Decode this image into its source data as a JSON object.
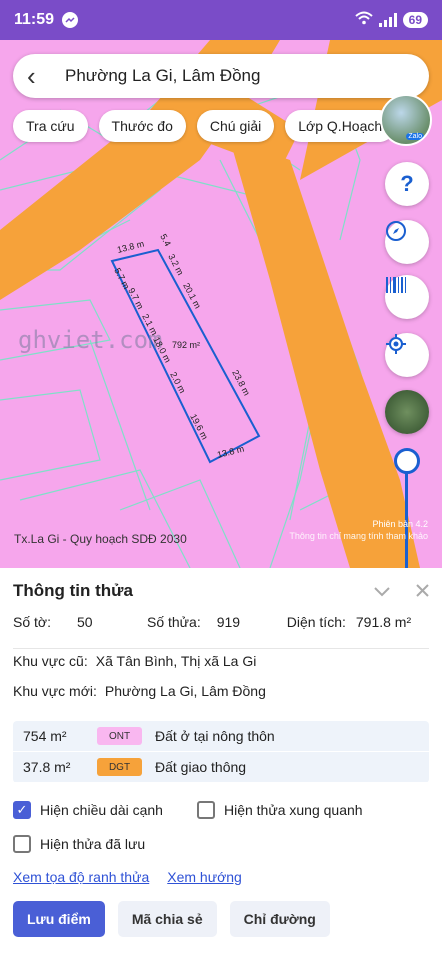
{
  "status": {
    "time": "11:59",
    "battery": "69"
  },
  "search": {
    "title": "Phường La Gi, Lâm Đồng"
  },
  "chips": [
    "Tra cứu",
    "Thước đo",
    "Chú giải",
    "Lớp Q.Hoạch"
  ],
  "avatar": {
    "badge": "Zalo"
  },
  "fab": {
    "help": "?"
  },
  "map": {
    "watermark": "ghviet.com",
    "dims": [
      "13.8 m",
      "5.4",
      "3.2 m",
      "20.1 m",
      "23.8 m",
      "19.6 m",
      "13.8 m",
      "5.7 m",
      "9.7 m",
      "2.1 m",
      "18.0 m",
      "2.0 m"
    ],
    "area_label": "792 m²",
    "version_line1": "Phiên bản 4.2",
    "version_line2": "Thông tin chỉ mang tính tham khảo",
    "layer_label": "Tx.La Gi - Quy hoạch SDĐ 2030",
    "colors": {
      "residential": "#f6a6ec",
      "road": "#f6a23a",
      "parcel_line": "#7fe0c8",
      "selected": "#1a5fd0"
    }
  },
  "panel": {
    "title": "Thông tin thửa",
    "so_to_label": "Số tờ:",
    "so_to": "50",
    "so_thua_label": "Số thửa:",
    "so_thua": "919",
    "dien_tich_label": "Diện tích:",
    "dien_tich": "791.8 m²",
    "kv_cu_label": "Khu vực cũ:",
    "kv_cu": "Xã Tân Bình, Thị xã La Gi",
    "kv_moi_label": "Khu vực mới:",
    "kv_moi": "Phường La Gi, Lâm Đồng",
    "landuse": [
      {
        "area": "754 m²",
        "code": "ONT",
        "desc": "Đất ở tại nông thôn"
      },
      {
        "area": "37.8 m²",
        "code": "DGT",
        "desc": "Đất giao thông"
      }
    ],
    "checks": {
      "show_edges": "Hiện chiều dài cạnh",
      "show_surrounding": "Hiện thửa xung quanh",
      "show_saved": "Hiện thửa đã lưu"
    },
    "links": {
      "coords": "Xem tọa độ ranh thửa",
      "direction": "Xem hướng"
    },
    "buttons": {
      "save": "Lưu điểm",
      "share": "Mã chia sẻ",
      "route": "Chỉ đường"
    }
  }
}
